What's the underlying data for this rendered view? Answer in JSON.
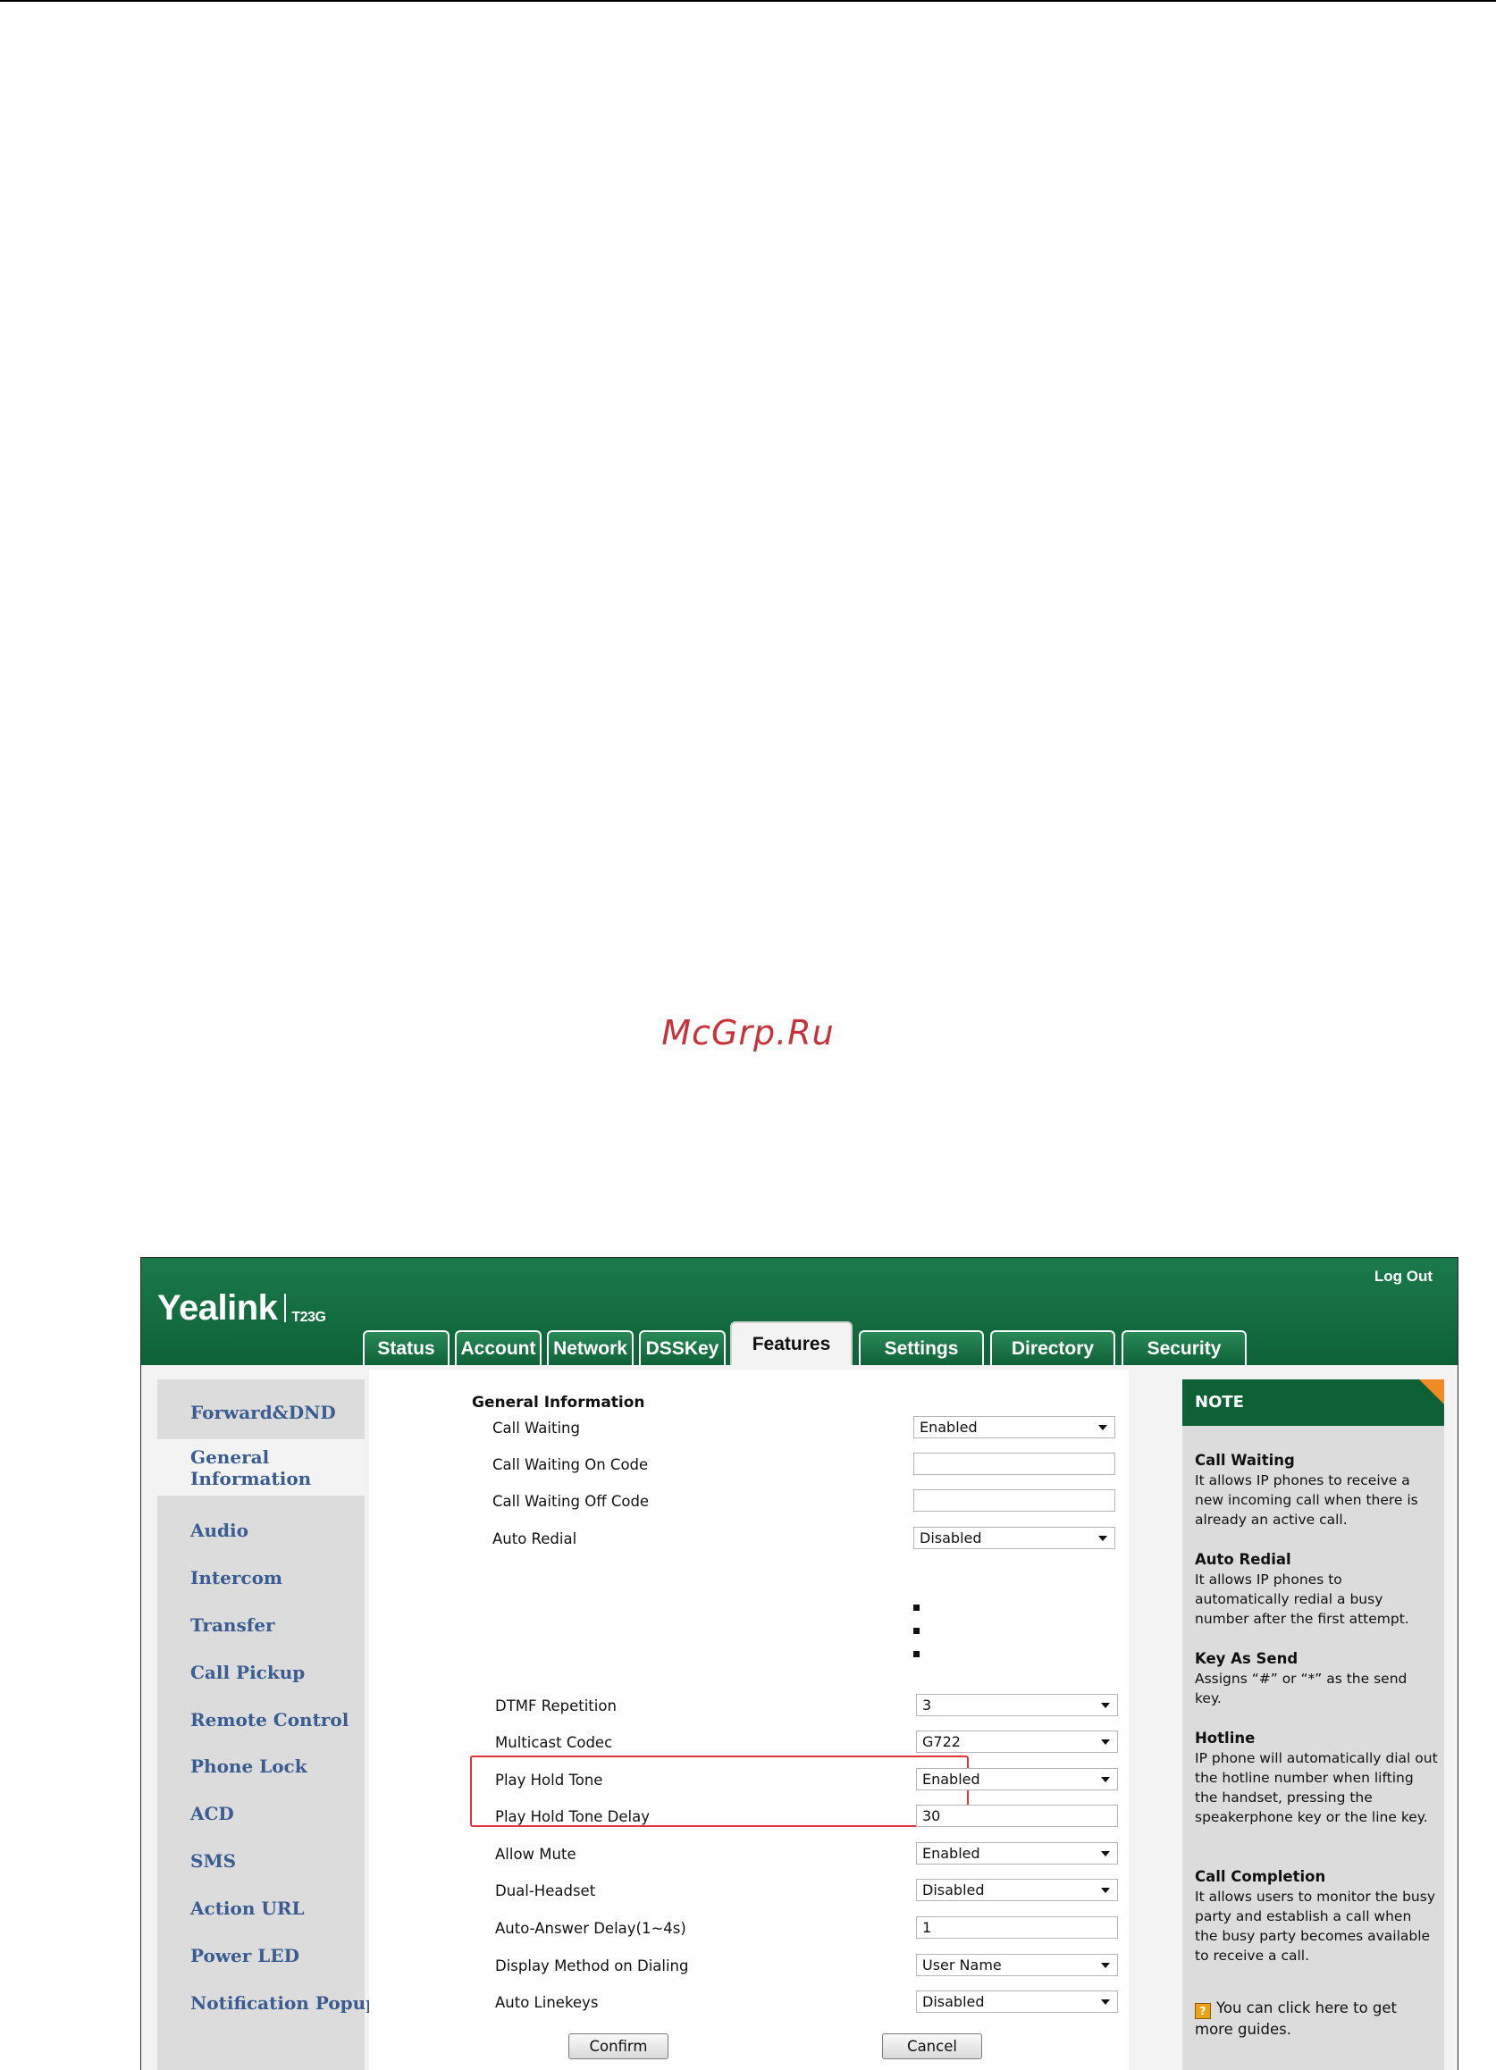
{
  "watermark": "McGrp.Ru",
  "header": {
    "brand": "Yealink",
    "model": "T23G",
    "logout_label": "Log Out"
  },
  "tabs": [
    {
      "label": "Status"
    },
    {
      "label": "Account"
    },
    {
      "label": "Network"
    },
    {
      "label": "DSSKey"
    },
    {
      "label": "Features",
      "active": true
    },
    {
      "label": "Settings"
    },
    {
      "label": "Directory"
    },
    {
      "label": "Security"
    }
  ],
  "sidebar": {
    "items": [
      {
        "label": "Forward&DND"
      },
      {
        "label": "General Information",
        "active": true
      },
      {
        "label": "Audio"
      },
      {
        "label": "Intercom"
      },
      {
        "label": "Transfer"
      },
      {
        "label": "Call Pickup"
      },
      {
        "label": "Remote Control"
      },
      {
        "label": "Phone Lock"
      },
      {
        "label": "ACD"
      },
      {
        "label": "SMS"
      },
      {
        "label": "Action URL"
      },
      {
        "label": "Power LED"
      },
      {
        "label": "Notification Popups"
      }
    ]
  },
  "form": {
    "section_title": "General Information",
    "fields_top": [
      {
        "label": "Call Waiting",
        "type": "select",
        "value": "Enabled"
      },
      {
        "label": "Call Waiting On Code",
        "type": "input",
        "value": ""
      },
      {
        "label": "Call Waiting Off Code",
        "type": "input",
        "value": ""
      },
      {
        "label": "Auto Redial",
        "type": "select",
        "value": "Disabled"
      }
    ],
    "fields_bottom": [
      {
        "label": "DTMF Repetition",
        "type": "select",
        "value": "3"
      },
      {
        "label": "Multicast Codec",
        "type": "select",
        "value": "G722"
      },
      {
        "label": "Play Hold Tone",
        "type": "select",
        "value": "Enabled"
      },
      {
        "label": "Play Hold Tone Delay",
        "type": "input",
        "value": "30"
      },
      {
        "label": "Allow Mute",
        "type": "select",
        "value": "Enabled"
      },
      {
        "label": "Dual-Headset",
        "type": "select",
        "value": "Disabled"
      },
      {
        "label": "Auto-Answer Delay(1~4s)",
        "type": "input",
        "value": "1"
      },
      {
        "label": "Display Method on Dialing",
        "type": "select",
        "value": "User Name"
      },
      {
        "label": "Auto Linekeys",
        "type": "select",
        "value": "Disabled"
      }
    ],
    "confirm_label": "Confirm",
    "cancel_label": "Cancel"
  },
  "note": {
    "title": "NOTE",
    "blocks": [
      {
        "title": "Call Waiting",
        "text": "It allows IP phones to receive a new incoming call when there is already an active call."
      },
      {
        "title": "Auto Redial",
        "text": "It allows IP phones to automatically redial a busy number after the first attempt."
      },
      {
        "title": "Key As Send",
        "text": "Assigns “#” or “*” as the send key."
      },
      {
        "title": "Hotline",
        "text": "IP phone will automatically dial out the hotline number when lifting the handset, pressing the speakerphone key or the line key."
      },
      {
        "title": "Call Completion",
        "text": "It allows users to monitor the busy party and establish a call when the busy party becomes available to receive a call."
      }
    ],
    "help_text": "You can click here to get more guides."
  },
  "colors": {
    "brand_green": "#0e6137",
    "highlight_red": "#e0333a",
    "note_corner": "#f08a24",
    "sidebar_link": "#3b5c91"
  },
  "icons": {
    "help": "help-book-icon",
    "select_arrow": "chevron-down-icon"
  }
}
